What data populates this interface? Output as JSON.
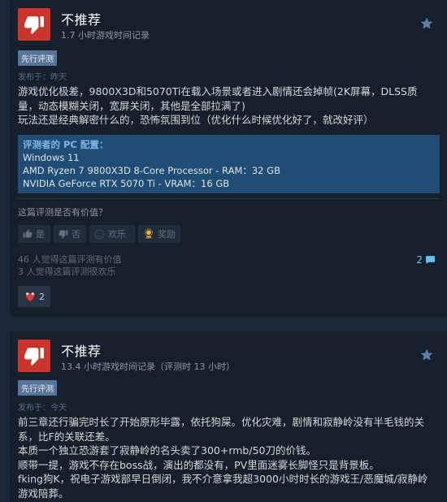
{
  "reviews": [
    {
      "verdict": "不推荐",
      "hours": "1.7 小时游戏时间记录",
      "badge": "先行评测",
      "posted": "发布于：昨天",
      "body": [
        "游戏优化极差，9800X3D和5070Ti在载入场景或者进入剧情还会掉帧(2K屏幕，DLSS质量，动态模糊关闭，宽屏关闭，其他是全部拉满了)",
        "玩法还是经典解密什么的，恐怖氛围到位（优化什么时候优化好了，就改好评）"
      ],
      "spec_title": "评测者的 PC 配置：",
      "spec_lines": [
        "Windows 11",
        "AMD Ryzen 7 9800X3D 8-Core Processor - RAM：32 GB",
        "NVIDIA GeForce RTX 5070 Ti - VRAM：16 GB"
      ],
      "helpful_question": "这篇评测是否有价值？",
      "buttons": {
        "yes": "是",
        "no": "否",
        "funny": "欢乐",
        "award": "奖励"
      },
      "stats": [
        "46 人觉得这篇评测有价值",
        "3 人觉得这篇评测很欢乐"
      ],
      "comment_count": "2",
      "award_count": "2"
    },
    {
      "verdict": "不推荐",
      "hours": "13.4 小时游戏时间记录（评测时 13 小时）",
      "badge": "先行评测",
      "posted": "发布于：今天",
      "body": [
        "前三章还行骗完时长了开始原形毕露，依托狗屎。优化灾难，剧情和寂静岭没有半毛钱的关系，比F的关联还差。",
        "本质一个独立恐游套了寂静岭的名头卖了300+rmb/50刀的价钱。",
        "顺带一提，游戏不存在boss战，演出的都没有，PV里面迷雾长脚怪只是背景板。",
        "fking狗K，祝电子游戏部早日倒闭，我不介意拿我超3000小时时长的游戏王/恶魔城/寂静岭游戏陪葬。"
      ]
    }
  ],
  "colors": {
    "thumb_bg": "#c8352d",
    "badge_bg": "#57749b",
    "spec_bg": "#1f4d75",
    "link": "#67c1f5"
  },
  "icons": {
    "verdict": "thumbs-down-icon",
    "favorite": "star-icon",
    "yes": "thumbs-up-icon",
    "no": "thumbs-down-icon",
    "funny": "smiley-icon",
    "award": "award-icon",
    "comments": "comment-bubble-icon",
    "award_chip": "heart-award-icon"
  }
}
